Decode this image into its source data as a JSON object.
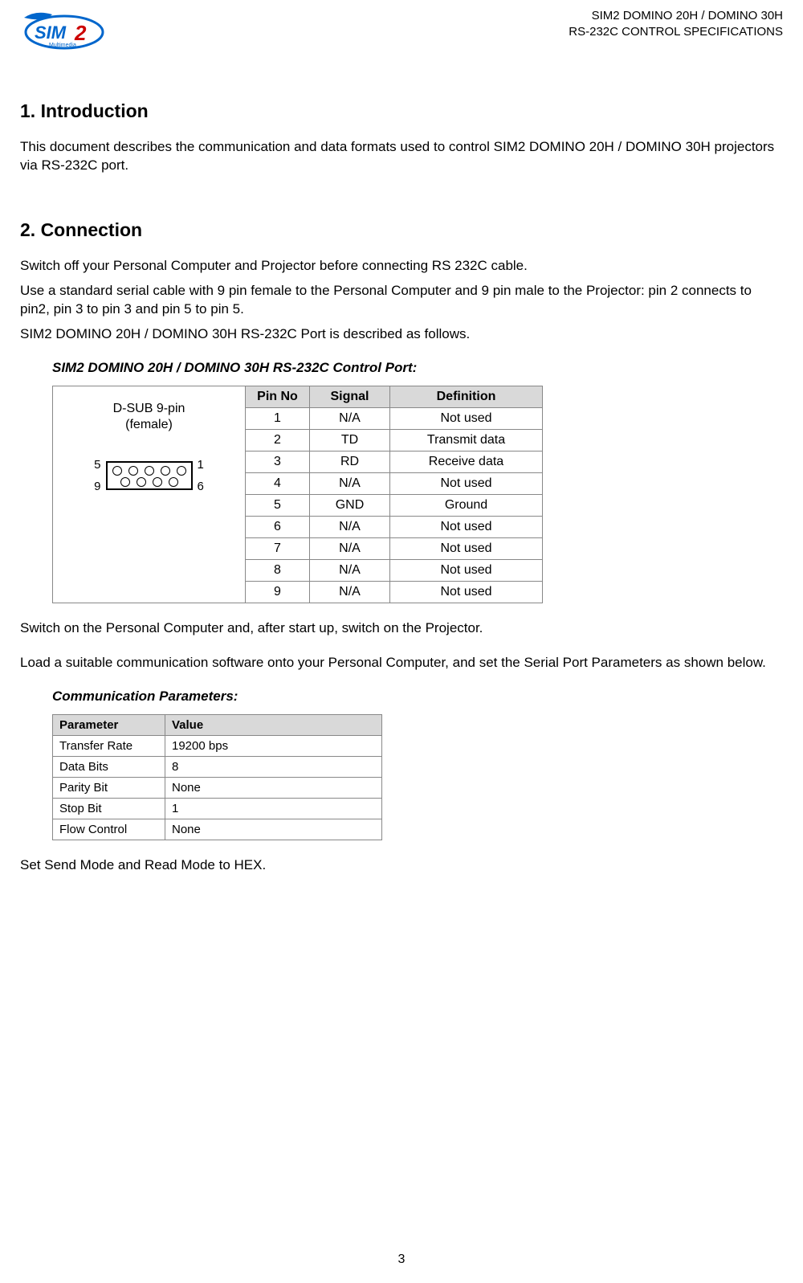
{
  "header": {
    "line1": "SIM2 DOMINO 20H / DOMINO 30H",
    "line2": "RS-232C CONTROL SPECIFICATIONS"
  },
  "sections": {
    "s1_title": "1. Introduction",
    "s1_p1": "This document describes the communication and data formats used to control SIM2 DOMINO 20H / DOMINO 30H projectors via RS-232C port.",
    "s2_title": "2. Connection",
    "s2_p1": "Switch off your Personal Computer and Projector before connecting RS 232C cable.",
    "s2_p2": "Use a standard serial cable with 9 pin female to the Personal Computer and 9 pin male to the Projector: pin 2 connects to pin2, pin 3 to pin 3 and pin 5 to pin 5.",
    "s2_p3": "SIM2 DOMINO 20H / DOMINO 30H RS-232C Port is described as follows.",
    "port_title": "SIM2 DOMINO 20H / DOMINO 30H RS-232C Control Port:",
    "connector_label_l1": "D-SUB 9-pin",
    "connector_label_l2": "(female)",
    "pin_labels": {
      "tl": "5",
      "tr": "1",
      "bl": "9",
      "br": "6"
    },
    "s2_p4": "Switch on the Personal Computer and, after start up, switch on the Projector.",
    "s2_p5": "Load a suitable communication software onto your Personal Computer, and set the Serial Port Parameters as shown below.",
    "params_title": "Communication Parameters:",
    "s2_p6": "Set Send Mode and Read Mode to HEX."
  },
  "pin_table": {
    "headers": [
      "Pin No",
      "Signal",
      "Definition"
    ],
    "rows": [
      [
        "1",
        "N/A",
        "Not used"
      ],
      [
        "2",
        "TD",
        "Transmit data"
      ],
      [
        "3",
        "RD",
        "Receive data"
      ],
      [
        "4",
        "N/A",
        "Not used"
      ],
      [
        "5",
        "GND",
        "Ground"
      ],
      [
        "6",
        "N/A",
        "Not used"
      ],
      [
        "7",
        "N/A",
        "Not used"
      ],
      [
        "8",
        "N/A",
        "Not used"
      ],
      [
        "9",
        "N/A",
        "Not used"
      ]
    ]
  },
  "param_table": {
    "headers": [
      "Parameter",
      "Value"
    ],
    "rows": [
      [
        "Transfer Rate",
        "19200 bps"
      ],
      [
        "Data Bits",
        "8"
      ],
      [
        "Parity Bit",
        "None"
      ],
      [
        "Stop Bit",
        "1"
      ],
      [
        "Flow Control",
        "None"
      ]
    ]
  },
  "page_number": "3"
}
